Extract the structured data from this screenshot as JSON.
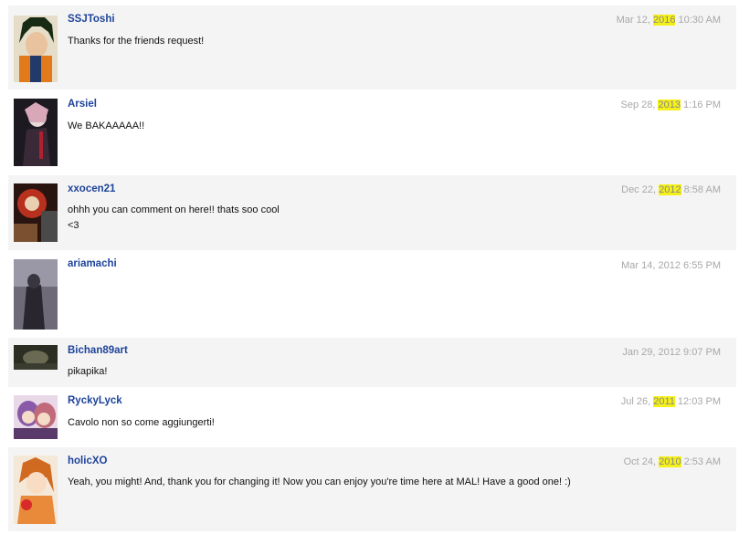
{
  "comments": [
    {
      "username": "SSJToshi",
      "date_pre": "Mar 12, ",
      "date_year": "2016",
      "date_post": " 10:30 AM",
      "year_highlighted": true,
      "lines": [
        "Thanks for the friends request!"
      ]
    },
    {
      "username": "Arsiel",
      "date_pre": "Sep 28, ",
      "date_year": "2013",
      "date_post": " 1:16 PM",
      "year_highlighted": true,
      "lines": [
        "We BAKAAAAA!!"
      ]
    },
    {
      "username": "xxocen21",
      "date_pre": "Dec 22, ",
      "date_year": "2012",
      "date_post": " 8:58 AM",
      "year_highlighted": true,
      "lines": [
        "ohhh you can comment on here!! thats soo cool",
        "<3"
      ]
    },
    {
      "username": "ariamachi",
      "date_pre": "Mar 14, ",
      "date_year": "2012",
      "date_post": " 6:55 PM",
      "year_highlighted": false,
      "lines": []
    },
    {
      "username": "Bichan89art",
      "date_pre": "Jan 29, ",
      "date_year": "2012",
      "date_post": " 9:07 PM",
      "year_highlighted": false,
      "lines": [
        "pikapika!"
      ]
    },
    {
      "username": "RyckyLyck",
      "date_pre": "Jul 26, ",
      "date_year": "2011",
      "date_post": " 12:03 PM",
      "year_highlighted": true,
      "lines": [
        "Cavolo non so come aggiungerti!"
      ]
    },
    {
      "username": "holicXO",
      "date_pre": "Oct 24, ",
      "date_year": "2010",
      "date_post": " 2:53 AM",
      "year_highlighted": true,
      "lines": [
        "Yeah, you might! And, thank you for changing it! Now you can enjoy you're time here at MAL! Have a good one! :)"
      ]
    }
  ],
  "colors": {
    "username": "#1d439b",
    "date": "#a8a8a8",
    "highlight": "#f5f018",
    "row_shaded": "#f4f4f4"
  }
}
